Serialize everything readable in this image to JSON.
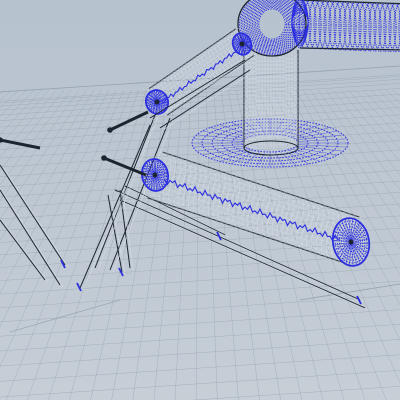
{
  "viewport": {
    "background_top": "#b7c2cf",
    "background_bottom": "#c6ced6",
    "grid_color": "#8d99a8",
    "wire_color": "#2c2fe0",
    "edge_color": "#1c2430",
    "ghost_color": "#d9e0e7"
  },
  "scene": {
    "objects": [
      {
        "name": "upper-arm-tube",
        "icon": "cylinder-icon"
      },
      {
        "name": "base-column",
        "icon": "cylinder-icon"
      },
      {
        "name": "base-disk",
        "icon": "disk-icon"
      },
      {
        "name": "elbow-joint",
        "icon": "joint-icon"
      },
      {
        "name": "flex-hose",
        "icon": "hose-icon"
      },
      {
        "name": "lower-arm-tube",
        "icon": "cylinder-icon"
      },
      {
        "name": "end-cap",
        "icon": "disk-icon"
      },
      {
        "name": "pistons",
        "icon": "rod-icon"
      },
      {
        "name": "brackets",
        "icon": "bracket-icon"
      }
    ]
  }
}
